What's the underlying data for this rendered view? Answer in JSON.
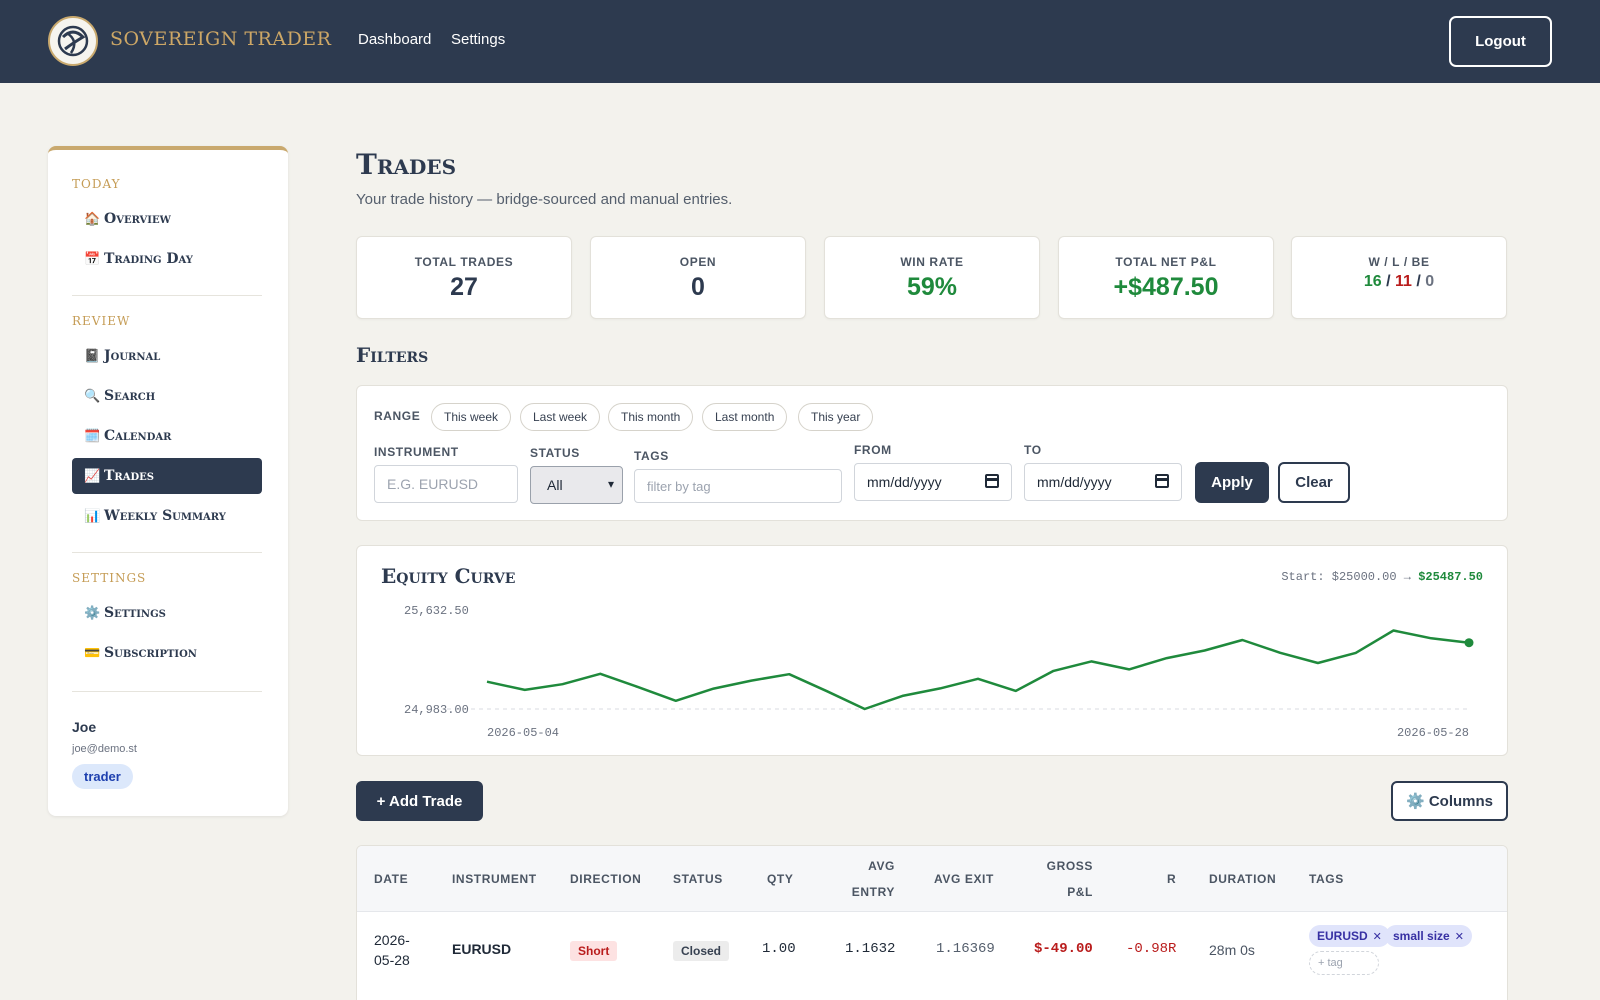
{
  "header": {
    "brand": "SOVEREIGN TRADER",
    "nav": [
      "Dashboard",
      "Settings"
    ],
    "logout": "Logout"
  },
  "sidebar": {
    "sections": [
      {
        "title": "TODAY",
        "items": [
          {
            "icon": "🏠",
            "label": "Overview"
          },
          {
            "icon": "📅",
            "label": "Trading Day"
          }
        ]
      },
      {
        "title": "REVIEW",
        "items": [
          {
            "icon": "📓",
            "label": "Journal"
          },
          {
            "icon": "🔍",
            "label": "Search"
          },
          {
            "icon": "🗓️",
            "label": "Calendar"
          },
          {
            "icon": "📈",
            "label": "Trades",
            "active": true
          },
          {
            "icon": "📊",
            "label": "Weekly Summary"
          }
        ]
      },
      {
        "title": "SETTINGS",
        "items": [
          {
            "icon": "⚙️",
            "label": "Settings"
          },
          {
            "icon": "💳",
            "label": "Subscription"
          }
        ]
      }
    ],
    "user": {
      "name": "Joe",
      "email": "joe@demo.st",
      "role": "trader"
    }
  },
  "page": {
    "title": "Trades",
    "subtitle": "Your trade history — bridge-sourced and manual entries."
  },
  "stats": {
    "total_trades": {
      "label": "TOTAL TRADES",
      "value": "27"
    },
    "open": {
      "label": "OPEN",
      "value": "0"
    },
    "win_rate": {
      "label": "WIN RATE",
      "value": "59%"
    },
    "net_pnl": {
      "label": "TOTAL NET P&L",
      "value": "+$487.50"
    },
    "wlbe": {
      "label": "W / L / BE",
      "wins": "16",
      "losses": "11",
      "be": "0",
      "sep": "/"
    }
  },
  "filters": {
    "title": "Filters",
    "range_label": "RANGE",
    "ranges": [
      "This week",
      "Last week",
      "This month",
      "Last month",
      "This year"
    ],
    "instrument_label": "INSTRUMENT",
    "instrument_placeholder": "E.G. EURUSD",
    "status_label": "STATUS",
    "status_value": "All",
    "tags_label": "TAGS",
    "tags_placeholder": "filter by tag",
    "from_label": "FROM",
    "from_value": "mm/dd/yyyy",
    "to_label": "TO",
    "to_value": "mm/dd/yyyy",
    "apply": "Apply",
    "clear": "Clear"
  },
  "equity": {
    "title": "Equity Curve",
    "start_text": "Start: $25000.00",
    "arrow": "→",
    "end_text": "$25487.50"
  },
  "chart_data": {
    "type": "line",
    "title": "Equity Curve",
    "y_max_label": "25,632.50",
    "y_min_label": "24,983.00",
    "x_start_label": "2026-05-04",
    "x_end_label": "2026-05-28",
    "ylim": [
      24983.0,
      25632.5
    ],
    "values": [
      25162,
      25108,
      25146,
      25214,
      25127,
      25037,
      25117,
      25169,
      25211,
      25100,
      24983,
      25069,
      25118,
      25181,
      25102,
      25233,
      25295,
      25243,
      25317,
      25367,
      25436,
      25352,
      25285,
      25351,
      25498,
      25447,
      25418
    ]
  },
  "actions": {
    "add_trade": "+ Add Trade",
    "columns": "⚙️ Columns"
  },
  "table": {
    "headers": [
      "DATE",
      "INSTRUMENT",
      "DIRECTION",
      "STATUS",
      "QTY",
      "AVG ENTRY",
      "AVG EXIT",
      "GROSS P&L",
      "R",
      "DURATION",
      "TAGS"
    ],
    "rows": [
      {
        "date": "2026-05-28",
        "instrument": "EURUSD",
        "direction": "Short",
        "status": "Closed",
        "qty": "1.00",
        "avg_entry": "1.1632",
        "avg_exit": "1.16369",
        "gross_pnl": "$-49.00",
        "r": "-0.98R",
        "duration": "28m 0s",
        "tags": [
          "EURUSD",
          "small size"
        ],
        "add_tag": "+ tag"
      }
    ]
  },
  "colors": {
    "navy": "#2d3a4f",
    "gold": "#c9a96e",
    "green": "#1f8a3c",
    "red": "#b91c1c"
  }
}
